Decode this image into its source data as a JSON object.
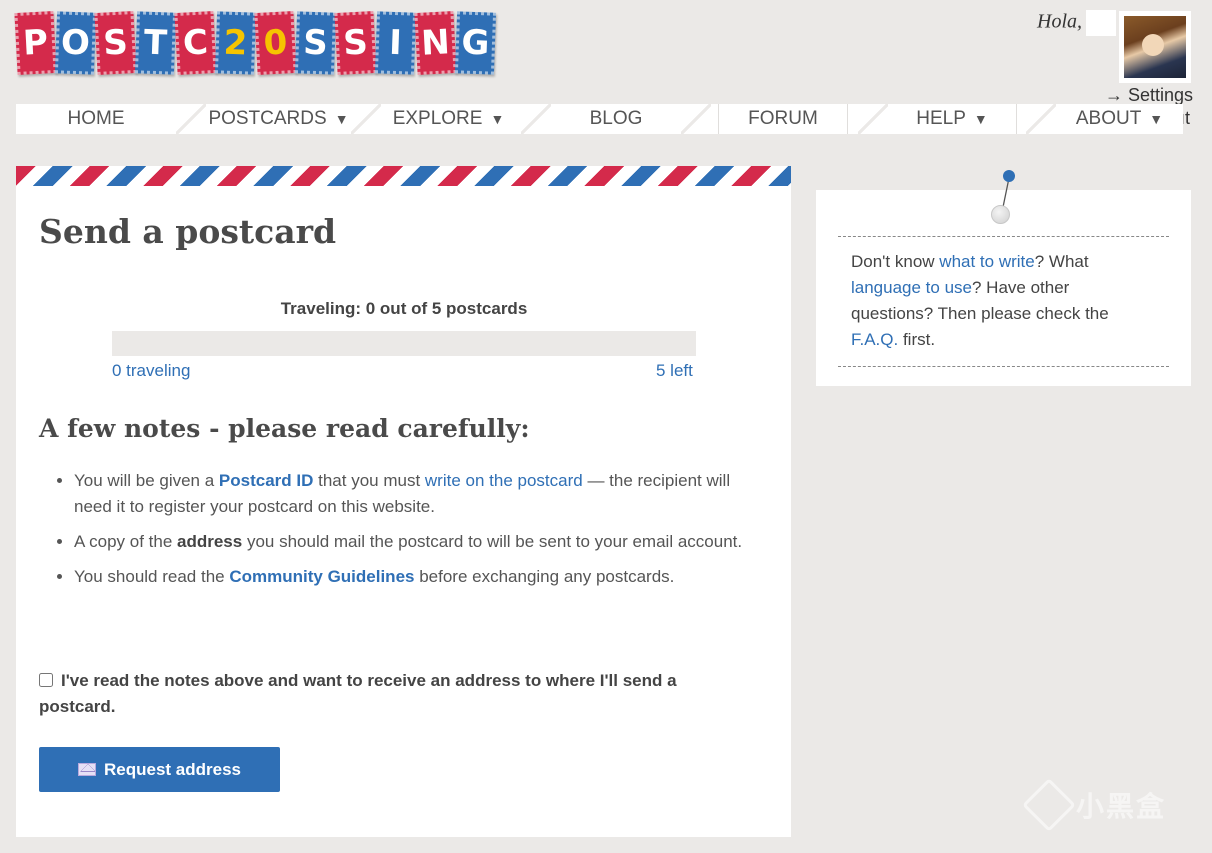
{
  "logo": {
    "letters": [
      {
        "char": "P",
        "color": "red"
      },
      {
        "char": "O",
        "color": "blue"
      },
      {
        "char": "S",
        "color": "red"
      },
      {
        "char": "T",
        "color": "blue"
      },
      {
        "char": "C",
        "color": "red"
      },
      {
        "char": "2",
        "color": "blue",
        "accent": "yellow"
      },
      {
        "char": "0",
        "color": "red",
        "accent": "yellow"
      },
      {
        "char": "S",
        "color": "blue"
      },
      {
        "char": "S",
        "color": "red"
      },
      {
        "char": "I",
        "color": "blue"
      },
      {
        "char": "N",
        "color": "red"
      },
      {
        "char": "G",
        "color": "blue"
      }
    ]
  },
  "user": {
    "greeting": "Hola,",
    "settings_link": "→ Settings",
    "logout_fragment": "ıt"
  },
  "nav": {
    "items": [
      {
        "label": "HOME",
        "dropdown": false
      },
      {
        "label": "POSTCARDS",
        "dropdown": true
      },
      {
        "label": "EXPLORE",
        "dropdown": true
      },
      {
        "label": "BLOG",
        "dropdown": false
      },
      {
        "label": "FORUM",
        "dropdown": false
      },
      {
        "label": "HELP",
        "dropdown": true
      },
      {
        "label": "ABOUT",
        "dropdown": true
      }
    ],
    "caret": "▼"
  },
  "main": {
    "title": "Send a postcard",
    "traveling_label": "Traveling: 0 out of 5 postcards",
    "progress_fraction": 0,
    "progress_left": "0 traveling",
    "progress_right": "5 left",
    "notes_title": "A few notes - please read carefully:",
    "notes": {
      "n1_a": "You will be given a ",
      "n1_b": "Postcard ID",
      "n1_c": " that you must ",
      "n1_d": "write on the postcard",
      "n1_e": " — the recipient will need it to register your postcard on this website.",
      "n2_a": "A copy of the ",
      "n2_b": "address",
      "n2_c": " you should mail the postcard to will be sent to your email account.",
      "n3_a": "You should read the ",
      "n3_b": "Community Guidelines",
      "n3_c": " before exchanging any postcards."
    },
    "confirm_label": "I've read the notes above and want to receive an address to where I'll send a postcard.",
    "confirm_checked": false,
    "request_button": "Request address"
  },
  "sidebar": {
    "s1": "Don't know ",
    "s2": "what to write",
    "s3": "? What ",
    "s4": "language to use",
    "s5": "? Have other questions? Then please check the ",
    "s6": "F.A.Q.",
    "s7": " first."
  },
  "watermark": {
    "text": "小黑盒"
  },
  "colors": {
    "red": "#d42a4b",
    "blue": "#2f6fb5",
    "yellow": "#f6c400",
    "background": "#ebe9e7"
  }
}
